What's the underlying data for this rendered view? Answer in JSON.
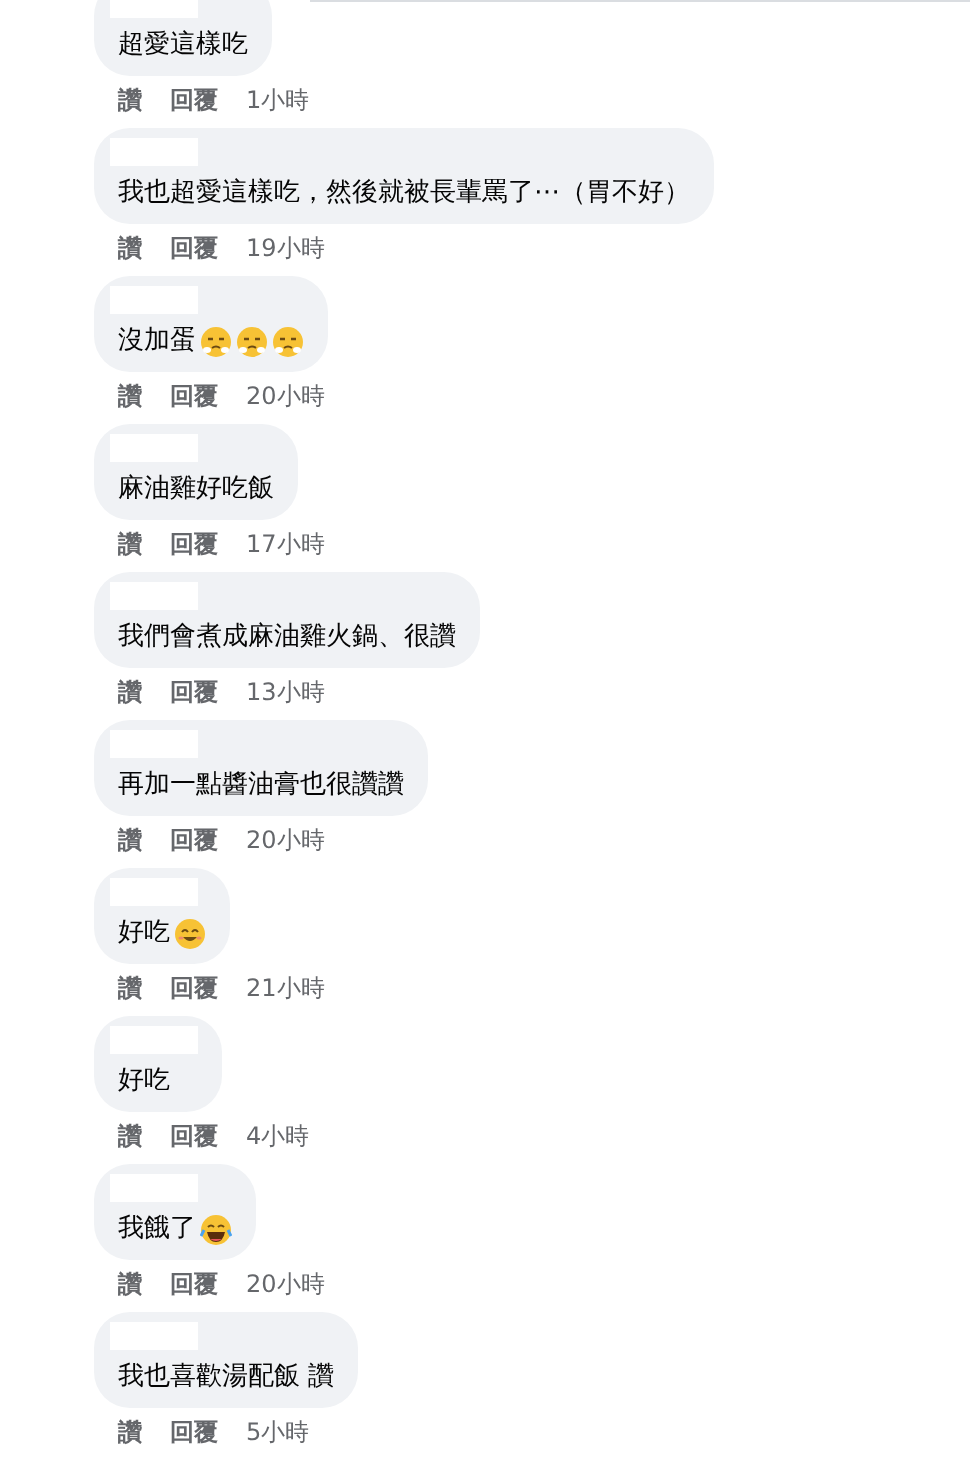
{
  "comments": [
    {
      "text": "超愛這樣吃",
      "actions": {
        "like": "讚",
        "reply": "回覆",
        "time": "1小時"
      }
    },
    {
      "text": "我也超愛這樣吃，然後就被長輩罵了⋯（胃不好）",
      "actions": {
        "like": "讚",
        "reply": "回覆",
        "time": "19小時"
      }
    },
    {
      "text": "沒加蛋",
      "emojis": [
        {
          "kind": "steam"
        },
        {
          "kind": "steam"
        },
        {
          "kind": "steam"
        }
      ],
      "actions": {
        "like": "讚",
        "reply": "回覆",
        "time": "20小時"
      }
    },
    {
      "text": "麻油雞好吃飯",
      "actions": {
        "like": "讚",
        "reply": "回覆",
        "time": "17小時"
      }
    },
    {
      "text": "我們會煮成麻油雞火鍋、很讚",
      "actions": {
        "like": "讚",
        "reply": "回覆",
        "time": "13小時"
      }
    },
    {
      "text": "再加一點醬油膏也很讚讚",
      "actions": {
        "like": "讚",
        "reply": "回覆",
        "time": "20小時"
      }
    },
    {
      "text": "好吃",
      "emojis": [
        {
          "kind": "smile"
        }
      ],
      "actions": {
        "like": "讚",
        "reply": "回覆",
        "time": "21小時"
      }
    },
    {
      "text": "好吃",
      "actions": {
        "like": "讚",
        "reply": "回覆",
        "time": "4小時"
      }
    },
    {
      "text": "我餓了",
      "emojis": [
        {
          "kind": "laugh"
        }
      ],
      "actions": {
        "like": "讚",
        "reply": "回覆",
        "time": "20小時"
      }
    },
    {
      "text": "我也喜歡湯配飯 讚",
      "actions": {
        "like": "讚",
        "reply": "回覆",
        "time": "5小時"
      }
    }
  ]
}
